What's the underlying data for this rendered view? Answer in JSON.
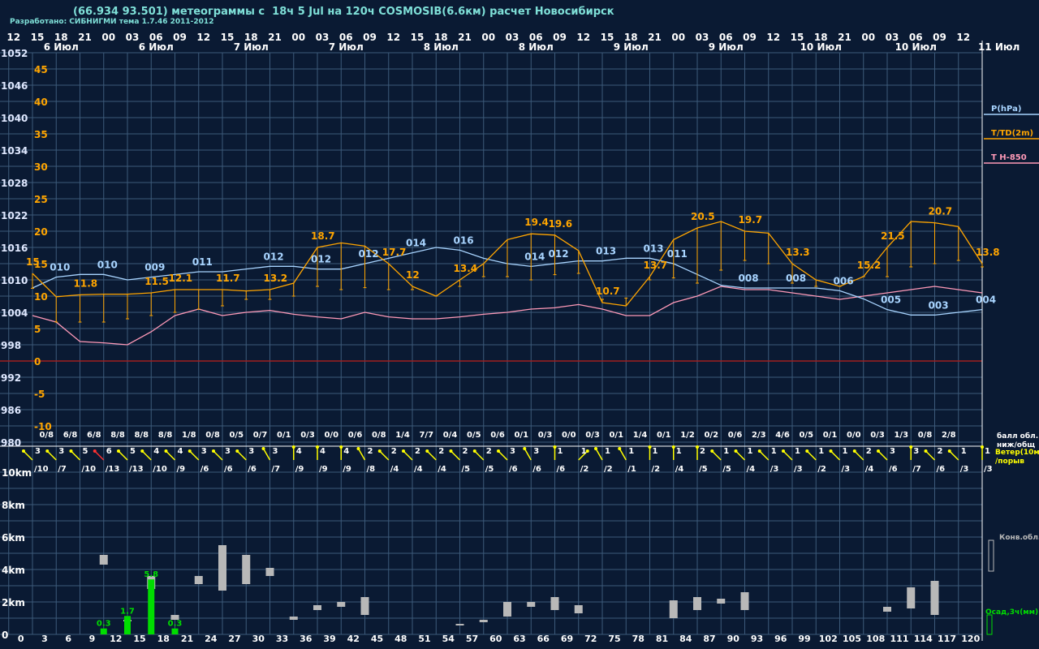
{
  "title": "(66.934 93.501) метеограммы с  18ч 5 Jul на 120ч COSMOSIB(6.6км) расчет Новосибирск",
  "subtitle": "Разработано: СИБНИГМИ тема 1.7.46 2011-2012",
  "colors": {
    "background": "#0a1a33",
    "grid": "#3c5a7a",
    "pressure": "#a8d4ff",
    "temperature": "#ffa500",
    "t850": "#ff9ab8",
    "zero_line": "#a02020",
    "precip": "#00dd00",
    "cloud": "#b8b8b8",
    "wind": "#ffff00",
    "wind_strong": "#ff3030"
  },
  "hour_labels": [
    "12",
    "15",
    "18",
    "21",
    "00",
    "03",
    "06",
    "09",
    "12",
    "15",
    "18",
    "21",
    "00",
    "03",
    "06",
    "09",
    "12",
    "15",
    "18",
    "21",
    "00",
    "03",
    "06",
    "09",
    "12",
    "15",
    "18",
    "21",
    "00",
    "03",
    "06",
    "09",
    "12",
    "15",
    "18",
    "21",
    "00",
    "03",
    "06",
    "09",
    "12"
  ],
  "day_labels": [
    {
      "t": 12,
      "text": "6 Июл"
    },
    {
      "t": 36,
      "text": "6 Июл"
    },
    {
      "t": 60,
      "text": "7 Июл"
    },
    {
      "t": 84,
      "text": "7 Июл"
    },
    {
      "t": 108,
      "text": "8 Июл"
    },
    {
      "t": 132,
      "text": "8 Июл"
    },
    {
      "t": 156,
      "text": "9 Июл"
    },
    {
      "t": 180,
      "text": "9 Июл"
    },
    {
      "t": 204,
      "text": "10 Июл"
    },
    {
      "t": 228,
      "text": "10 Июл"
    },
    {
      "t": 249,
      "text": "11 Июл"
    }
  ],
  "pressure_axis": [
    "1052",
    "1046",
    "1040",
    "1034",
    "1028",
    "1022",
    "1016",
    "1010",
    "1004",
    "998",
    "992",
    "986",
    "980"
  ],
  "temperature_axis": [
    "45",
    "40",
    "35",
    "30",
    "25",
    "20",
    "15",
    "10",
    "5",
    "0",
    "-5",
    "-10"
  ],
  "height_axis": [
    "10km",
    "8km",
    "6km",
    "4km",
    "2km",
    "0"
  ],
  "forecast_hours": [
    "0",
    "3",
    "6",
    "9",
    "12",
    "15",
    "18",
    "21",
    "24",
    "27",
    "30",
    "33",
    "36",
    "39",
    "42",
    "45",
    "48",
    "51",
    "54",
    "57",
    "60",
    "63",
    "66",
    "69",
    "72",
    "75",
    "78",
    "81",
    "84",
    "87",
    "90",
    "93",
    "96",
    "99",
    "102",
    "105",
    "108",
    "111",
    "114",
    "117",
    "120"
  ],
  "legend": {
    "pressure": "P(hPa)",
    "temperature": "T/TD(2m)",
    "t850": "T H-850",
    "cloud_label_1": "балл обл.",
    "cloud_label_2": "ниж/общ",
    "wind_label_1": "Ветер(10м)",
    "wind_label_2": "/порыв",
    "conv_cloud": "Конв.обл.",
    "precip": "Осад,3ч(мм)"
  },
  "chart_data": {
    "type": "line",
    "x": [
      0,
      3,
      6,
      9,
      12,
      15,
      18,
      21,
      24,
      27,
      30,
      33,
      36,
      39,
      42,
      45,
      48,
      51,
      54,
      57,
      60,
      63,
      66,
      69,
      72,
      75,
      78,
      81,
      84,
      87,
      90,
      93,
      96,
      99,
      102,
      105,
      108,
      111,
      114,
      117,
      120
    ],
    "pressure": [
      1008.5,
      1010.5,
      1011,
      1011,
      1010,
      1010.5,
      1011,
      1011.5,
      1011.5,
      1012,
      1012.5,
      1012.5,
      1012,
      1012,
      1013,
      1014,
      1015,
      1016,
      1015.5,
      1014,
      1013,
      1012.5,
      1013,
      1013.5,
      1013.5,
      1014,
      1014,
      1013,
      1011,
      1009,
      1008.5,
      1008.5,
      1008.5,
      1008.5,
      1008,
      1006.5,
      1004.5,
      1003.5,
      1003.5,
      1004,
      1004.5
    ],
    "temperature": [
      13.5,
      9.9,
      10.2,
      10.3,
      10.3,
      10.5,
      11,
      11,
      11,
      10.8,
      11,
      12,
      17.5,
      18.2,
      17.7,
      15,
      11.5,
      10,
      12.5,
      15,
      18.7,
      19.6,
      19.4,
      17,
      9,
      8.5,
      13,
      18.7,
      20.5,
      21.5,
      20,
      19.7,
      15,
      12.5,
      11.5,
      13,
      17.5,
      21.5,
      21.3,
      20.7,
      15
    ],
    "dewpoint": [
      11.2,
      6,
      6,
      6,
      6.5,
      7,
      7.5,
      8,
      8.5,
      9.5,
      9.5,
      10,
      11.5,
      11,
      11.3,
      11,
      11,
      10,
      11.5,
      13,
      13,
      12.5,
      13.3,
      13.5,
      9.5,
      9.7,
      12.5,
      12.8,
      12,
      14,
      15.5,
      15,
      12,
      11.5,
      11.5,
      13,
      13,
      14.5,
      15,
      15.5,
      14.5
    ],
    "t850": [
      7,
      6,
      3,
      2.8,
      2.5,
      4.5,
      7,
      8,
      7,
      7.5,
      7.8,
      7.2,
      6.8,
      6.5,
      7.5,
      6.8,
      6.5,
      6.5,
      6.8,
      7.2,
      7.5,
      8,
      8.2,
      8.7,
      8,
      7,
      7,
      9,
      10,
      11.5,
      11,
      11,
      10.5,
      10,
      9.5,
      10,
      10.5,
      11,
      11.5,
      11,
      10.5
    ],
    "pressure_labels": [
      {
        "t": 3,
        "text": "010"
      },
      {
        "t": 12,
        "text": "010"
      },
      {
        "t": 18,
        "text": "009"
      },
      {
        "t": 27,
        "text": "011"
      },
      {
        "t": 36,
        "text": "012"
      },
      {
        "t": 45,
        "text": "012"
      },
      {
        "t": 54,
        "text": "012"
      },
      {
        "t": 60,
        "text": "014"
      },
      {
        "t": 69,
        "text": "016"
      },
      {
        "t": 78,
        "text": "014"
      },
      {
        "t": 84,
        "text": "012"
      },
      {
        "t": 90,
        "text": "013"
      },
      {
        "t": 96,
        "text": "013"
      },
      {
        "t": 102,
        "text": "011"
      },
      {
        "t": 111,
        "text": "008"
      },
      {
        "t": 120,
        "text": "008"
      },
      {
        "t": 126,
        "text": "006"
      },
      {
        "t": 135,
        "text": "005"
      },
      {
        "t": 141,
        "text": "003"
      },
      {
        "t": 150,
        "text": "004"
      }
    ],
    "temperature_labels": [
      {
        "t": 0,
        "text": "15"
      },
      {
        "t": 9,
        "text": "11.8"
      },
      {
        "t": 18,
        "text": "11.5"
      },
      {
        "t": 24,
        "text": "12.1"
      },
      {
        "t": 30,
        "text": "11.7"
      },
      {
        "t": 39,
        "text": "13.2"
      },
      {
        "t": 48,
        "text": "18.7"
      },
      {
        "t": 57,
        "text": "17.7"
      },
      {
        "t": 63,
        "text": "12"
      },
      {
        "t": 72,
        "text": "13.4"
      },
      {
        "t": 81,
        "text": "19.4"
      },
      {
        "t": 87,
        "text": "19.6"
      },
      {
        "t": 93,
        "text": "10.7"
      },
      {
        "t": 102,
        "text": "13.7"
      },
      {
        "t": 111,
        "text": "20.5"
      },
      {
        "t": 117,
        "text": "19.7"
      },
      {
        "t": 126,
        "text": "13.3"
      },
      {
        "t": 135,
        "text": "15.2"
      },
      {
        "t": 141,
        "text": "21.5"
      },
      {
        "t": 147,
        "text": "20.7"
      },
      {
        "t": 156,
        "text": "13.8"
      }
    ],
    "cloud_cover": [
      "0/8",
      "6/8",
      "6/8",
      "8/8",
      "8/8",
      "8/8",
      "1/8",
      "0/8",
      "0/5",
      "0/7",
      "0/1",
      "0/3",
      "0/0",
      "0/6",
      "0/8",
      "1/4",
      "7/7",
      "0/4",
      "0/5",
      "0/6",
      "0/1",
      "0/3",
      "0/0",
      "0/3",
      "0/1",
      "1/4",
      "0/1",
      "1/2",
      "0/2",
      "0/6",
      "2/3",
      "4/6",
      "0/5",
      "0/1",
      "0/0",
      "0/3",
      "1/3",
      "0/8",
      "2/8"
    ],
    "wind": [
      {
        "s": "3",
        "g": "/10",
        "dir": 315
      },
      {
        "s": "3",
        "g": "/7",
        "dir": 315
      },
      {
        "s": "5",
        "g": "/10",
        "dir": 315
      },
      {
        "s": "6",
        "g": "/13",
        "dir": 315,
        "strong": true
      },
      {
        "s": "5",
        "g": "/13",
        "dir": 315
      },
      {
        "s": "4",
        "g": "/10",
        "dir": 315
      },
      {
        "s": "4",
        "g": "/9",
        "dir": 315
      },
      {
        "s": "3",
        "g": "/6",
        "dir": 315
      },
      {
        "s": "3",
        "g": "/6",
        "dir": 315
      },
      {
        "s": "3",
        "g": "/6",
        "dir": 315
      },
      {
        "s": "3",
        "g": "/7",
        "dir": 330
      },
      {
        "s": "4",
        "g": "/9",
        "dir": 0
      },
      {
        "s": "4",
        "g": "/9",
        "dir": 0
      },
      {
        "s": "4",
        "g": "/9",
        "dir": 0
      },
      {
        "s": "2",
        "g": "/8",
        "dir": 330
      },
      {
        "s": "2",
        "g": "/4",
        "dir": 315
      },
      {
        "s": "2",
        "g": "/4",
        "dir": 315
      },
      {
        "s": "2",
        "g": "/4",
        "dir": 315
      },
      {
        "s": "2",
        "g": "/5",
        "dir": 315
      },
      {
        "s": "2",
        "g": "/5",
        "dir": 315
      },
      {
        "s": "3",
        "g": "/6",
        "dir": 315
      },
      {
        "s": "3",
        "g": "/6",
        "dir": 330
      },
      {
        "s": "1",
        "g": "/6",
        "dir": 0
      },
      {
        "s": "1",
        "g": "/2",
        "dir": 45
      },
      {
        "s": "1",
        "g": "/2",
        "dir": 330
      },
      {
        "s": "1",
        "g": "/1",
        "dir": 330
      },
      {
        "s": "1",
        "g": "/2",
        "dir": 0
      },
      {
        "s": "1",
        "g": "/4",
        "dir": 0
      },
      {
        "s": "2",
        "g": "/5",
        "dir": 0
      },
      {
        "s": "1",
        "g": "/5",
        "dir": 315
      },
      {
        "s": "1",
        "g": "/4",
        "dir": 315
      },
      {
        "s": "1",
        "g": "/3",
        "dir": 315
      },
      {
        "s": "1",
        "g": "/3",
        "dir": 315
      },
      {
        "s": "1",
        "g": "/2",
        "dir": 315
      },
      {
        "s": "1",
        "g": "/3",
        "dir": 315
      },
      {
        "s": "2",
        "g": "/4",
        "dir": 315
      },
      {
        "s": "3",
        "g": "/6",
        "dir": 315
      },
      {
        "s": "3",
        "g": "/7",
        "dir": 0
      },
      {
        "s": "2",
        "g": "/6",
        "dir": 315
      },
      {
        "s": "1",
        "g": "/3",
        "dir": 315
      },
      {
        "s": "1",
        "g": "/3",
        "dir": 0
      }
    ],
    "precipitation": [
      {
        "t": 9,
        "value": 0.3
      },
      {
        "t": 12,
        "value": 1.7
      },
      {
        "t": 15,
        "value": 5.8
      },
      {
        "t": 18,
        "value": 0.3
      }
    ],
    "convective_clouds": [
      {
        "t": 9,
        "base_km": 4.3,
        "top_km": 4.9
      },
      {
        "t": 12,
        "base_km": 0.8,
        "top_km": 0.9
      },
      {
        "t": 15,
        "base_km": 2.8,
        "top_km": 3.6
      },
      {
        "t": 18,
        "base_km": 0.9,
        "top_km": 1.2
      },
      {
        "t": 21,
        "base_km": 3.1,
        "top_km": 3.6
      },
      {
        "t": 24,
        "base_km": 2.7,
        "top_km": 5.5
      },
      {
        "t": 27,
        "base_km": 3.1,
        "top_km": 4.9
      },
      {
        "t": 30,
        "base_km": 3.6,
        "top_km": 4.1
      },
      {
        "t": 33,
        "base_km": 0.9,
        "top_km": 1.1
      },
      {
        "t": 36,
        "base_km": 1.5,
        "top_km": 1.8
      },
      {
        "t": 39,
        "base_km": 1.7,
        "top_km": 2.0
      },
      {
        "t": 42,
        "base_km": 1.2,
        "top_km": 2.3
      },
      {
        "t": 54,
        "base_km": 0.55,
        "top_km": 0.65
      },
      {
        "t": 57,
        "base_km": 0.75,
        "top_km": 0.9
      },
      {
        "t": 60,
        "base_km": 1.1,
        "top_km": 2.0
      },
      {
        "t": 63,
        "base_km": 1.7,
        "top_km": 2.0
      },
      {
        "t": 66,
        "base_km": 1.5,
        "top_km": 2.3
      },
      {
        "t": 69,
        "base_km": 1.3,
        "top_km": 1.8
      },
      {
        "t": 81,
        "base_km": 1.0,
        "top_km": 2.1
      },
      {
        "t": 84,
        "base_km": 1.5,
        "top_km": 2.3
      },
      {
        "t": 87,
        "base_km": 1.9,
        "top_km": 2.2
      },
      {
        "t": 90,
        "base_km": 1.5,
        "top_km": 2.6
      },
      {
        "t": 108,
        "base_km": 1.4,
        "top_km": 1.7
      },
      {
        "t": 111,
        "base_km": 1.6,
        "top_km": 2.9
      },
      {
        "t": 114,
        "base_km": 1.2,
        "top_km": 3.3
      }
    ],
    "pressure_range": [
      980,
      1052
    ],
    "temperature_range": [
      -10,
      45
    ],
    "height_range_km": [
      0,
      10
    ],
    "grid": true
  }
}
